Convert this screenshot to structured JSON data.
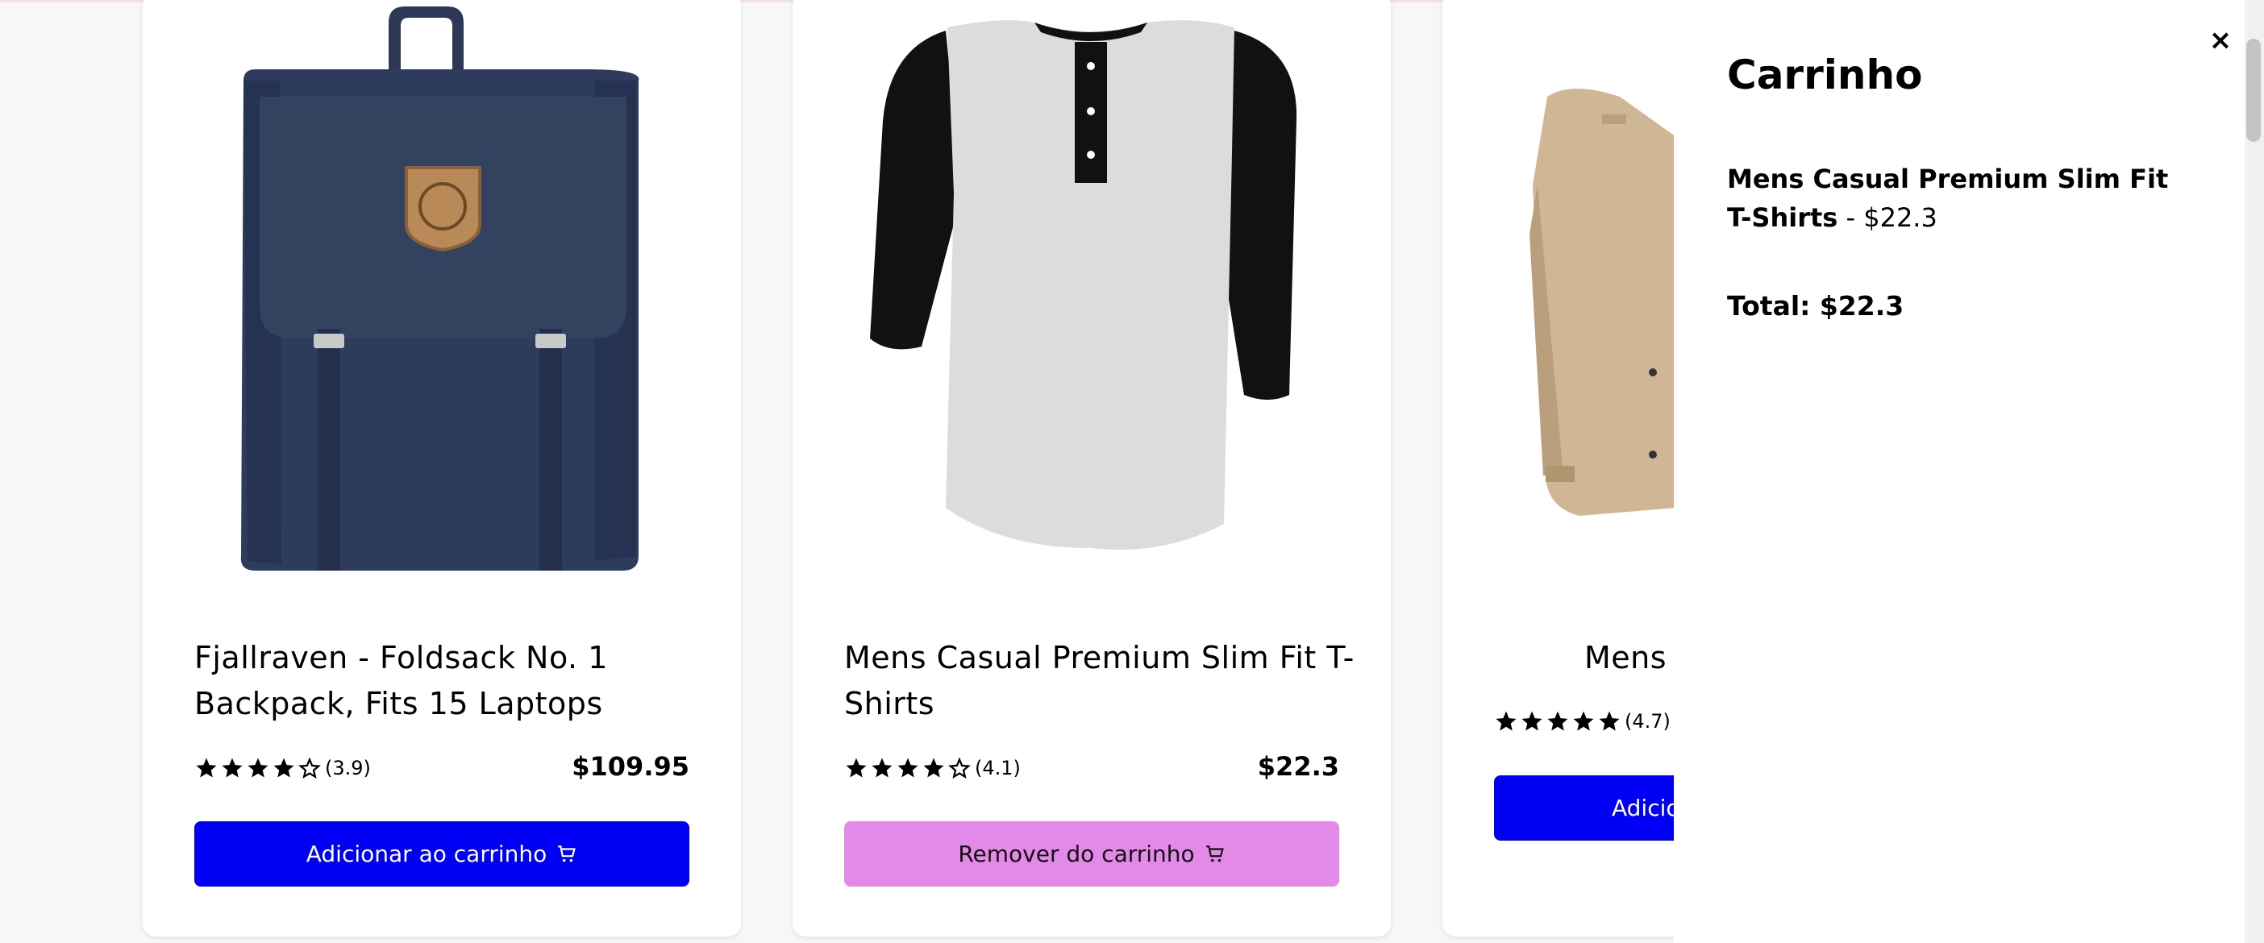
{
  "products": [
    {
      "title": "Fjallraven - Foldsack No. 1 Backpack, Fits 15 Laptops",
      "rating": 3.9,
      "rating_text": "(3.9)",
      "price": "$109.95",
      "button_label": "Adicionar ao carrinho",
      "in_cart": false
    },
    {
      "title": "Mens Casual Premium Slim Fit T-Shirts",
      "rating": 4.1,
      "rating_text": "(4.1)",
      "price": "$22.3",
      "button_label": "Remover do carrinho",
      "in_cart": true
    },
    {
      "title": "Mens",
      "rating": 4.7,
      "rating_text": "(4.7)",
      "button_label": "Adicio",
      "in_cart": false
    }
  ],
  "cart": {
    "title": "Carrinho",
    "close_label": "×",
    "items": [
      {
        "name": "Mens Casual Premium Slim Fit T-Shirts",
        "separator": " - ",
        "price": "$22.3"
      }
    ],
    "total_label": "Total: $22.3"
  },
  "colors": {
    "add_button": "#0000f5",
    "remove_button": "#e389e8"
  },
  "icons": {
    "star": "star-icon",
    "cart": "cart-icon",
    "close": "close-icon"
  }
}
